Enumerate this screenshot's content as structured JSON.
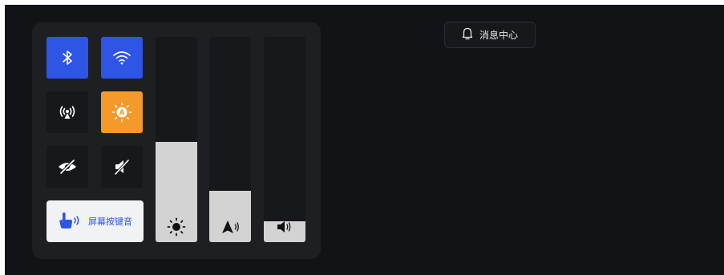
{
  "control_panel": {
    "toggles": [
      {
        "name": "bluetooth",
        "state": "on"
      },
      {
        "name": "wifi",
        "state": "on"
      },
      {
        "name": "hotspot",
        "state": "off"
      },
      {
        "name": "auto-brightness",
        "state": "on"
      },
      {
        "name": "privacy",
        "state": "off"
      },
      {
        "name": "mute",
        "state": "off"
      }
    ],
    "screen_touch_sound_label": "屏幕按键音",
    "sliders": {
      "brightness": {
        "level": 0.49
      },
      "navigation_volume": {
        "level": 0.25
      },
      "media_volume": {
        "level": 0.1
      }
    }
  },
  "notification_center": {
    "label": "消息中心"
  },
  "colors": {
    "active_blue": "#2f55e6",
    "active_orange": "#f39a2a"
  }
}
